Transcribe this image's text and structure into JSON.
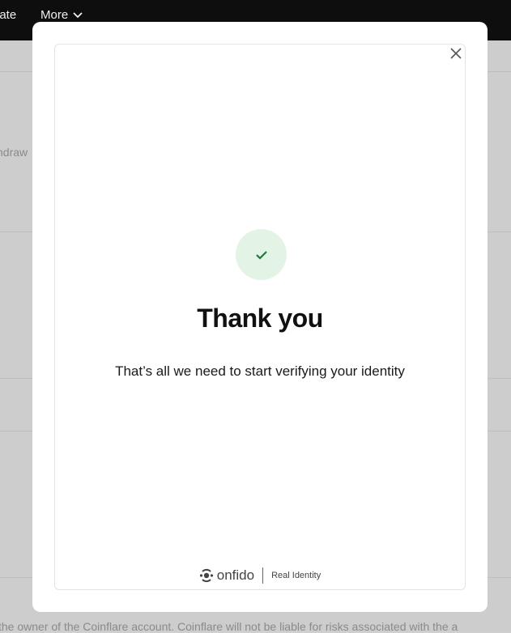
{
  "topbar": {
    "left_item": "late",
    "more_label": "More"
  },
  "background": {
    "side_text": "ndraw",
    "footer_text": "the owner of the Coinflare account. Coinflare will not be liable for risks associated with the a"
  },
  "modal": {
    "close_icon": "close-icon",
    "success_icon": "checkmark-icon",
    "title": "Thank you",
    "subtitle": "That’s all we need to start verifying your identity",
    "footer": {
      "brand": "onfido",
      "tagline": "Real Identity"
    }
  },
  "colors": {
    "check_bg": "#e3f4e6",
    "check_stroke": "#1e7a34"
  }
}
